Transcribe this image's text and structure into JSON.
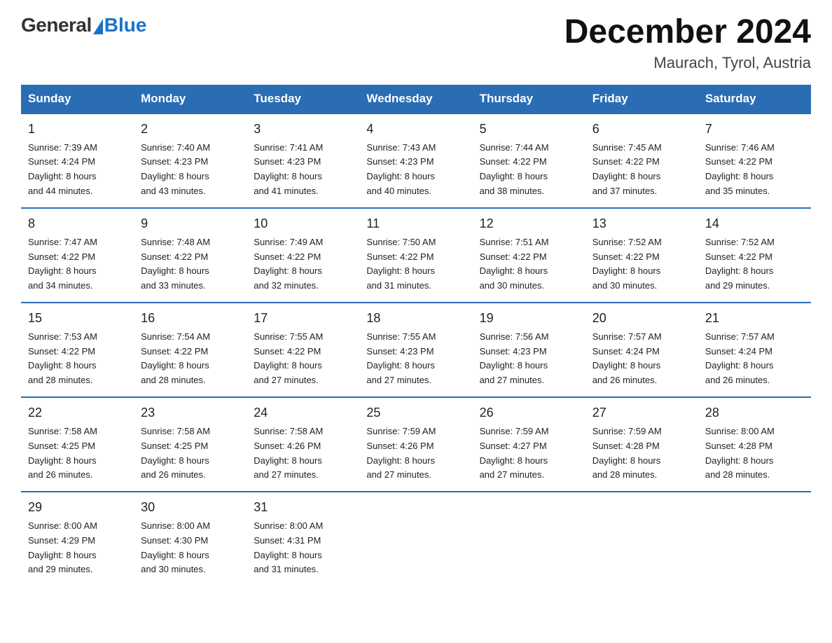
{
  "header": {
    "logo_general": "General",
    "logo_blue": "Blue",
    "title": "December 2024",
    "location": "Maurach, Tyrol, Austria"
  },
  "weekdays": [
    "Sunday",
    "Monday",
    "Tuesday",
    "Wednesday",
    "Thursday",
    "Friday",
    "Saturday"
  ],
  "weeks": [
    [
      {
        "day": "1",
        "sunrise": "Sunrise: 7:39 AM",
        "sunset": "Sunset: 4:24 PM",
        "daylight": "Daylight: 8 hours",
        "daylight2": "and 44 minutes."
      },
      {
        "day": "2",
        "sunrise": "Sunrise: 7:40 AM",
        "sunset": "Sunset: 4:23 PM",
        "daylight": "Daylight: 8 hours",
        "daylight2": "and 43 minutes."
      },
      {
        "day": "3",
        "sunrise": "Sunrise: 7:41 AM",
        "sunset": "Sunset: 4:23 PM",
        "daylight": "Daylight: 8 hours",
        "daylight2": "and 41 minutes."
      },
      {
        "day": "4",
        "sunrise": "Sunrise: 7:43 AM",
        "sunset": "Sunset: 4:23 PM",
        "daylight": "Daylight: 8 hours",
        "daylight2": "and 40 minutes."
      },
      {
        "day": "5",
        "sunrise": "Sunrise: 7:44 AM",
        "sunset": "Sunset: 4:22 PM",
        "daylight": "Daylight: 8 hours",
        "daylight2": "and 38 minutes."
      },
      {
        "day": "6",
        "sunrise": "Sunrise: 7:45 AM",
        "sunset": "Sunset: 4:22 PM",
        "daylight": "Daylight: 8 hours",
        "daylight2": "and 37 minutes."
      },
      {
        "day": "7",
        "sunrise": "Sunrise: 7:46 AM",
        "sunset": "Sunset: 4:22 PM",
        "daylight": "Daylight: 8 hours",
        "daylight2": "and 35 minutes."
      }
    ],
    [
      {
        "day": "8",
        "sunrise": "Sunrise: 7:47 AM",
        "sunset": "Sunset: 4:22 PM",
        "daylight": "Daylight: 8 hours",
        "daylight2": "and 34 minutes."
      },
      {
        "day": "9",
        "sunrise": "Sunrise: 7:48 AM",
        "sunset": "Sunset: 4:22 PM",
        "daylight": "Daylight: 8 hours",
        "daylight2": "and 33 minutes."
      },
      {
        "day": "10",
        "sunrise": "Sunrise: 7:49 AM",
        "sunset": "Sunset: 4:22 PM",
        "daylight": "Daylight: 8 hours",
        "daylight2": "and 32 minutes."
      },
      {
        "day": "11",
        "sunrise": "Sunrise: 7:50 AM",
        "sunset": "Sunset: 4:22 PM",
        "daylight": "Daylight: 8 hours",
        "daylight2": "and 31 minutes."
      },
      {
        "day": "12",
        "sunrise": "Sunrise: 7:51 AM",
        "sunset": "Sunset: 4:22 PM",
        "daylight": "Daylight: 8 hours",
        "daylight2": "and 30 minutes."
      },
      {
        "day": "13",
        "sunrise": "Sunrise: 7:52 AM",
        "sunset": "Sunset: 4:22 PM",
        "daylight": "Daylight: 8 hours",
        "daylight2": "and 30 minutes."
      },
      {
        "day": "14",
        "sunrise": "Sunrise: 7:52 AM",
        "sunset": "Sunset: 4:22 PM",
        "daylight": "Daylight: 8 hours",
        "daylight2": "and 29 minutes."
      }
    ],
    [
      {
        "day": "15",
        "sunrise": "Sunrise: 7:53 AM",
        "sunset": "Sunset: 4:22 PM",
        "daylight": "Daylight: 8 hours",
        "daylight2": "and 28 minutes."
      },
      {
        "day": "16",
        "sunrise": "Sunrise: 7:54 AM",
        "sunset": "Sunset: 4:22 PM",
        "daylight": "Daylight: 8 hours",
        "daylight2": "and 28 minutes."
      },
      {
        "day": "17",
        "sunrise": "Sunrise: 7:55 AM",
        "sunset": "Sunset: 4:22 PM",
        "daylight": "Daylight: 8 hours",
        "daylight2": "and 27 minutes."
      },
      {
        "day": "18",
        "sunrise": "Sunrise: 7:55 AM",
        "sunset": "Sunset: 4:23 PM",
        "daylight": "Daylight: 8 hours",
        "daylight2": "and 27 minutes."
      },
      {
        "day": "19",
        "sunrise": "Sunrise: 7:56 AM",
        "sunset": "Sunset: 4:23 PM",
        "daylight": "Daylight: 8 hours",
        "daylight2": "and 27 minutes."
      },
      {
        "day": "20",
        "sunrise": "Sunrise: 7:57 AM",
        "sunset": "Sunset: 4:24 PM",
        "daylight": "Daylight: 8 hours",
        "daylight2": "and 26 minutes."
      },
      {
        "day": "21",
        "sunrise": "Sunrise: 7:57 AM",
        "sunset": "Sunset: 4:24 PM",
        "daylight": "Daylight: 8 hours",
        "daylight2": "and 26 minutes."
      }
    ],
    [
      {
        "day": "22",
        "sunrise": "Sunrise: 7:58 AM",
        "sunset": "Sunset: 4:25 PM",
        "daylight": "Daylight: 8 hours",
        "daylight2": "and 26 minutes."
      },
      {
        "day": "23",
        "sunrise": "Sunrise: 7:58 AM",
        "sunset": "Sunset: 4:25 PM",
        "daylight": "Daylight: 8 hours",
        "daylight2": "and 26 minutes."
      },
      {
        "day": "24",
        "sunrise": "Sunrise: 7:58 AM",
        "sunset": "Sunset: 4:26 PM",
        "daylight": "Daylight: 8 hours",
        "daylight2": "and 27 minutes."
      },
      {
        "day": "25",
        "sunrise": "Sunrise: 7:59 AM",
        "sunset": "Sunset: 4:26 PM",
        "daylight": "Daylight: 8 hours",
        "daylight2": "and 27 minutes."
      },
      {
        "day": "26",
        "sunrise": "Sunrise: 7:59 AM",
        "sunset": "Sunset: 4:27 PM",
        "daylight": "Daylight: 8 hours",
        "daylight2": "and 27 minutes."
      },
      {
        "day": "27",
        "sunrise": "Sunrise: 7:59 AM",
        "sunset": "Sunset: 4:28 PM",
        "daylight": "Daylight: 8 hours",
        "daylight2": "and 28 minutes."
      },
      {
        "day": "28",
        "sunrise": "Sunrise: 8:00 AM",
        "sunset": "Sunset: 4:28 PM",
        "daylight": "Daylight: 8 hours",
        "daylight2": "and 28 minutes."
      }
    ],
    [
      {
        "day": "29",
        "sunrise": "Sunrise: 8:00 AM",
        "sunset": "Sunset: 4:29 PM",
        "daylight": "Daylight: 8 hours",
        "daylight2": "and 29 minutes."
      },
      {
        "day": "30",
        "sunrise": "Sunrise: 8:00 AM",
        "sunset": "Sunset: 4:30 PM",
        "daylight": "Daylight: 8 hours",
        "daylight2": "and 30 minutes."
      },
      {
        "day": "31",
        "sunrise": "Sunrise: 8:00 AM",
        "sunset": "Sunset: 4:31 PM",
        "daylight": "Daylight: 8 hours",
        "daylight2": "and 31 minutes."
      },
      {
        "day": "",
        "sunrise": "",
        "sunset": "",
        "daylight": "",
        "daylight2": ""
      },
      {
        "day": "",
        "sunrise": "",
        "sunset": "",
        "daylight": "",
        "daylight2": ""
      },
      {
        "day": "",
        "sunrise": "",
        "sunset": "",
        "daylight": "",
        "daylight2": ""
      },
      {
        "day": "",
        "sunrise": "",
        "sunset": "",
        "daylight": "",
        "daylight2": ""
      }
    ]
  ]
}
